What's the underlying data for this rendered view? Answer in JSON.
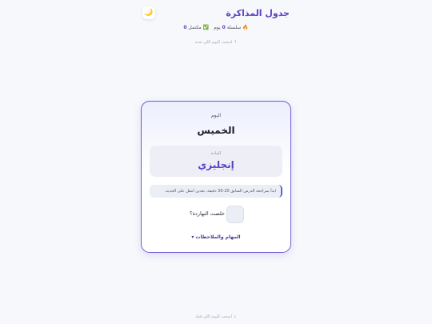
{
  "header": {
    "title": "جدول المذاكرة",
    "theme_toggle_icon": "🌙"
  },
  "stats": {
    "streak_icon": "🔥",
    "streak_label": "سلسلة",
    "streak_value": "0",
    "streak_unit": "يوم",
    "completed_icon": "✅",
    "completed_label": "مكتمل",
    "completed_value": "0"
  },
  "hints": {
    "top": "↑ اسحب لليوم اللي بعده",
    "bottom": "↓ اسحب لليوم اللي قبله"
  },
  "card": {
    "day_label": "اليوم",
    "day": "الخميس",
    "subject_label": "المادة",
    "subject": "إنجليزي",
    "tip": "ابدأ بمراجعة الدرس السابق 20-30 دقيقة، بعدين انتقل على الجديد.",
    "done_question": "خلصت النهاردة؟",
    "notes_toggle": "المهام والملاحظات ▾"
  },
  "colors": {
    "accent": "#5b3fc4",
    "card_border": "#6b5bd6"
  }
}
